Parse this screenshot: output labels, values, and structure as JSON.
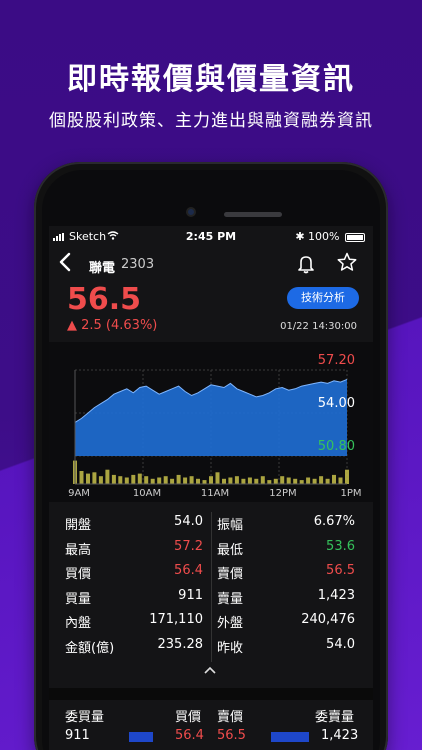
{
  "promo": {
    "headline": "即時報價與價量資訊",
    "subline": "個股股利政策、主力進出與融資融券資訊"
  },
  "status_bar": {
    "carrier": "Sketch",
    "time": "2:45 PM",
    "battery": "100%"
  },
  "header": {
    "stock_name": "聯電",
    "stock_code": "2303"
  },
  "quote": {
    "price": "56.5",
    "change": "▲ 2.5 (4.63%)",
    "tech_button": "技術分析",
    "datetime": "01/22 14:30:00"
  },
  "chart_data": {
    "type": "area",
    "x_ticks": [
      "9AM",
      "10AM",
      "11AM",
      "12PM",
      "1PM"
    ],
    "y_ticks": [
      {
        "value": "57.20",
        "color": "#ef4c4c"
      },
      {
        "value": "54.00",
        "color": "#ffffff"
      },
      {
        "value": "50.80",
        "color": "#35c25b"
      }
    ],
    "ylim": [
      50.8,
      57.2
    ],
    "reference": 54.0,
    "price_series": [
      53.3,
      53.6,
      54.0,
      54.4,
      54.7,
      55.0,
      55.4,
      55.6,
      55.8,
      55.5,
      55.9,
      56.0,
      55.7,
      55.4,
      55.6,
      55.8,
      56.0,
      55.6,
      55.3,
      55.5,
      55.8,
      56.1,
      56.0,
      55.9,
      56.2,
      55.8,
      55.6,
      55.4,
      55.2,
      55.3,
      55.5,
      55.8,
      55.9,
      55.7,
      55.8,
      56.0,
      56.1,
      56.2,
      56.3,
      56.2,
      56.4,
      56.3,
      56.5
    ],
    "volume_series": [
      0.9,
      0.5,
      0.4,
      0.45,
      0.3,
      0.55,
      0.35,
      0.3,
      0.25,
      0.35,
      0.4,
      0.3,
      0.2,
      0.25,
      0.3,
      0.2,
      0.35,
      0.25,
      0.3,
      0.2,
      0.15,
      0.3,
      0.45,
      0.2,
      0.25,
      0.3,
      0.2,
      0.25,
      0.2,
      0.3,
      0.15,
      0.2,
      0.3,
      0.25,
      0.2,
      0.15,
      0.25,
      0.2,
      0.3,
      0.2,
      0.35,
      0.25,
      0.55
    ],
    "colors": {
      "area": "#1f6fd6",
      "volume": "#c8c14a",
      "grid": "#3a3a3a"
    }
  },
  "stats": [
    {
      "label1": "開盤",
      "value1": "54.0",
      "color1": "",
      "label2": "振幅",
      "value2": "6.67%",
      "color2": ""
    },
    {
      "label1": "最高",
      "value1": "57.2",
      "color1": "red",
      "label2": "最低",
      "value2": "53.6",
      "color2": "green"
    },
    {
      "label1": "買價",
      "value1": "56.4",
      "color1": "red",
      "label2": "賣價",
      "value2": "56.5",
      "color2": "red"
    },
    {
      "label1": "買量",
      "value1": "911",
      "color1": "",
      "label2": "賣量",
      "value2": "1,423",
      "color2": ""
    },
    {
      "label1": "內盤",
      "value1": "171,110",
      "color1": "",
      "label2": "外盤",
      "value2": "240,476",
      "color2": ""
    },
    {
      "label1": "金額(億)",
      "value1": "235.28",
      "color1": "",
      "label2": "昨收",
      "value2": "54.0",
      "color2": ""
    }
  ],
  "order_book": {
    "headers": [
      "委買量",
      "買價",
      "賣價",
      "委賣量"
    ],
    "row": {
      "bid_vol": "911",
      "bid": "56.4",
      "ask": "56.5",
      "ask_vol": "1,423"
    }
  }
}
